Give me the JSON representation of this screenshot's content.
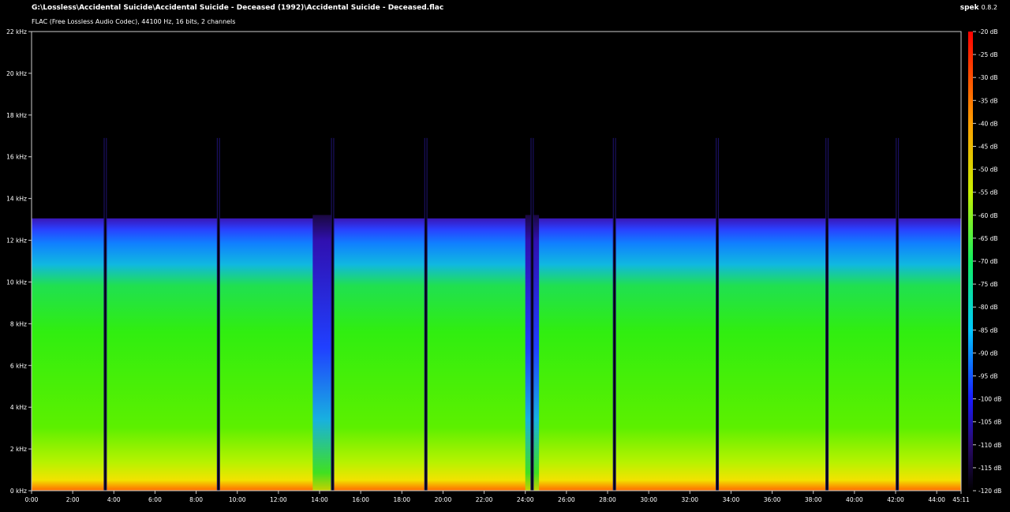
{
  "header": {
    "file_path": "G:\\Lossless\\Accidental Suicide\\Accidental Suicide - Deceased (1992)\\Accidental Suicide - Deceased.flac",
    "file_info": "FLAC (Free Lossless Audio Codec), 44100 Hz, 16 bits, 2 channels",
    "app_name": "spek",
    "app_version": "0.8.2"
  },
  "chart_data": {
    "type": "heatmap",
    "title": "",
    "frequency_axis": {
      "unit": "kHz",
      "range": [
        0,
        22
      ],
      "ticks": [
        "0 kHz",
        "2 kHz",
        "4 kHz",
        "6 kHz",
        "8 kHz",
        "10 kHz",
        "12 kHz",
        "14 kHz",
        "16 kHz",
        "18 kHz",
        "20 kHz",
        "22 kHz"
      ]
    },
    "time_axis": {
      "range_seconds": [
        0,
        2711
      ],
      "ticks": [
        "0:00",
        "2:00",
        "4:00",
        "6:00",
        "8:00",
        "10:00",
        "12:00",
        "14:00",
        "16:00",
        "18:00",
        "20:00",
        "22:00",
        "24:00",
        "26:00",
        "28:00",
        "30:00",
        "32:00",
        "34:00",
        "36:00",
        "38:00",
        "40:00",
        "42:00",
        "44:00",
        "45:11"
      ]
    },
    "color_scale": {
      "unit": "dB",
      "range": [
        -120,
        -20
      ],
      "ticks": [
        "-20 dB",
        "-25 dB",
        "-30 dB",
        "-35 dB",
        "-40 dB",
        "-45 dB",
        "-50 dB",
        "-55 dB",
        "-60 dB",
        "-65 dB",
        "-70 dB",
        "-75 dB",
        "-80 dB",
        "-85 dB",
        "-90 dB",
        "-95 dB",
        "-100 dB",
        "-105 dB",
        "-110 dB",
        "-115 dB",
        "-120 dB"
      ]
    },
    "content_cutoff_khz": 16.9,
    "track_boundaries_time": [
      "3:35",
      "9:05",
      "14:38",
      "19:10",
      "24:20",
      "28:20",
      "33:20",
      "38:40",
      "42:05"
    ],
    "quiet_segments_time": [
      [
        "13:40",
        "14:38"
      ],
      [
        "24:00",
        "24:40"
      ]
    ]
  }
}
